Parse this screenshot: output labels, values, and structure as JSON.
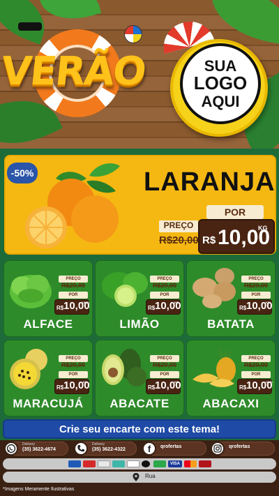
{
  "header": {
    "title": "VERÃO",
    "logo": {
      "line1": "SUA",
      "line2": "LOGO",
      "line3": "AQUI"
    }
  },
  "feature": {
    "discount": "-50%",
    "name": "LARANJA",
    "por_label": "POR",
    "preco_label": "PREÇO",
    "old_price": "R$20,00",
    "currency": "R$",
    "price": "10,00",
    "unit": "KG"
  },
  "products": [
    {
      "name": "ALFACE",
      "preco_label": "PREÇO",
      "old_price": "R$20,00",
      "por_label": "POR",
      "currency": "R$",
      "price": "10,00",
      "unit": "UNID."
    },
    {
      "name": "LIMÃO",
      "preco_label": "PREÇO",
      "old_price": "R$20,00",
      "por_label": "POR",
      "currency": "R$",
      "price": "10,00",
      "unit": "KG"
    },
    {
      "name": "BATATA",
      "preco_label": "PREÇO",
      "old_price": "R$20,00",
      "por_label": "POR",
      "currency": "R$",
      "price": "10,00",
      "unit": "KG"
    },
    {
      "name": "MARACUJÁ",
      "preco_label": "PREÇO",
      "old_price": "R$20,00",
      "por_label": "POR",
      "currency": "R$",
      "price": "10,00",
      "unit": "KG"
    },
    {
      "name": "ABACATE",
      "preco_label": "PREÇO",
      "old_price": "R$20,00",
      "por_label": "POR",
      "currency": "R$",
      "price": "10,00",
      "unit": "KG"
    },
    {
      "name": "ABACAXI",
      "preco_label": "PREÇO",
      "old_price": "R$20,00",
      "por_label": "POR",
      "currency": "R$",
      "price": "10,00",
      "unit": "UNID."
    }
  ],
  "banner": "Crie seu encarte com este tema!",
  "contacts": {
    "whatsapp": {
      "label": "Delivery",
      "value": "(35) 3622-4674",
      "icon": "whatsapp-icon"
    },
    "phone": {
      "label": "Delivery",
      "value": "(35) 3622-4322",
      "icon": "phone-icon"
    },
    "facebook": {
      "value": "qrofertas",
      "icon": "facebook-icon"
    },
    "instagram": {
      "value": "qrofertas",
      "icon": "instagram-icon"
    }
  },
  "payment": {
    "visa": "VISA",
    "icons": [
      "card-icon",
      "card-icon",
      "boleto-icon",
      "pix-icon",
      "elo-icon",
      "card-icon",
      "visa-icon",
      "mastercard-icon",
      "hipercard-icon"
    ]
  },
  "address": "Rua",
  "footnote": "*Imagens Meramente Ilustrativas",
  "colors": {
    "green": "#2e8b2a",
    "orange": "#f5b812",
    "brown": "#4a2412",
    "blue": "#1f4aa6"
  }
}
